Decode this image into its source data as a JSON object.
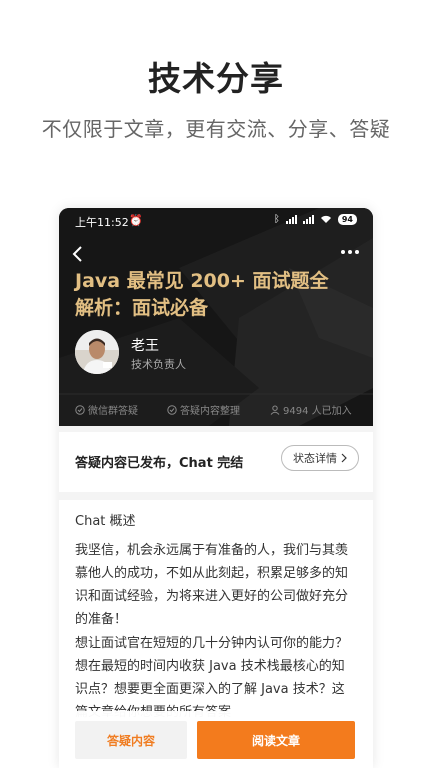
{
  "promo": {
    "title": "技术分享",
    "subtitle": "不仅限于文章，更有交流、分享、答疑"
  },
  "statusbar": {
    "time": "上午11:52",
    "battery": "94"
  },
  "article": {
    "title": "Java 最常见 200+ 面试题全解析：面试必备",
    "author_name": "老王",
    "author_role": "技术负责人",
    "features": [
      {
        "icon": "check-circle-icon",
        "label": "微信群答疑"
      },
      {
        "icon": "check-circle-icon",
        "label": "答疑内容整理"
      },
      {
        "icon": "person-icon",
        "label": "9494 人已加入"
      }
    ]
  },
  "status": {
    "text": "答疑内容已发布，Chat 完结",
    "button_label": "状态详情"
  },
  "overview": {
    "title": "Chat 概述",
    "para1": "我坚信，机会永远属于有准备的人，我们与其羡慕他人的成功，不如从此刻起，积累足够多的知识和面试经验，为将来进入更好的公司做好充分的准备！",
    "para2": "想让面试官在短短的几十分钟内认可你的能力？想在最短的时间内收获 Java 技术栈最核心的知识点？想要更全面更深入的了解 Java 技术？这篇文章给你想要的所有答案"
  },
  "bottom": {
    "qa_label": "答疑内容",
    "read_label": "阅读文章"
  },
  "colors": {
    "accent": "#f37b1d",
    "title_gold": "#e2bf83",
    "hero_bg": "#1a1a1a"
  }
}
